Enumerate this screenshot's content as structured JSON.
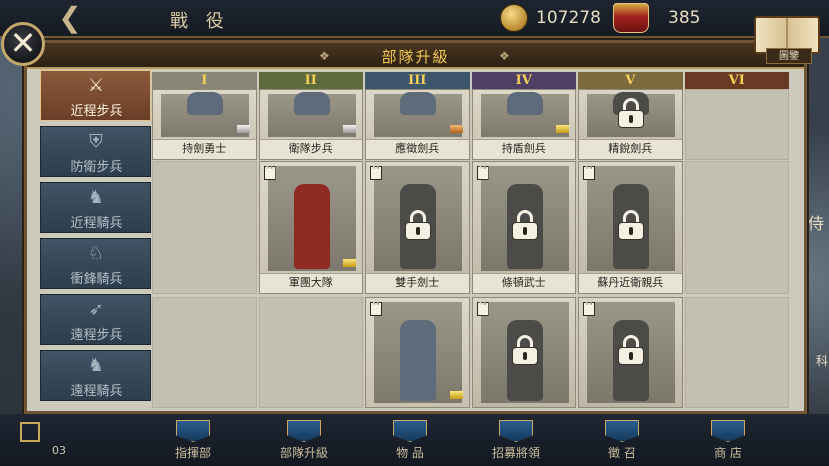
{
  "topbar": {
    "title": "戰 役",
    "coins": "107278",
    "crowns": "385"
  },
  "codex": {
    "label": "圖鑒"
  },
  "panel": {
    "title": "部隊升級"
  },
  "sidebar": {
    "items": [
      {
        "label": "近程步兵",
        "icon": "crossed-swords-icon",
        "active": true
      },
      {
        "label": "防衛步兵",
        "icon": "shield-icon",
        "active": false
      },
      {
        "label": "近程騎兵",
        "icon": "horse-head-icon",
        "active": false
      },
      {
        "label": "衝鋒騎兵",
        "icon": "charging-horse-icon",
        "active": false
      },
      {
        "label": "遠程步兵",
        "icon": "bow-icon",
        "active": false
      },
      {
        "label": "遠程騎兵",
        "icon": "horse-archer-icon",
        "active": false
      }
    ]
  },
  "tiers": [
    "I",
    "II",
    "III",
    "IV",
    "V",
    "VI"
  ],
  "tier_colors": [
    "#8a8676",
    "#5d6a3e",
    "#3d556b",
    "#4e3f66",
    "#7a6a3e",
    "#6a3b24"
  ],
  "units": {
    "row1": [
      {
        "name": "持劍勇士",
        "locked": false,
        "badge": "silver"
      },
      {
        "name": "衛隊步兵",
        "locked": false,
        "badge": "silver"
      },
      {
        "name": "應徵劍兵",
        "locked": false,
        "badge": "bronze"
      },
      {
        "name": "持盾劍兵",
        "locked": false,
        "badge": "gold"
      },
      {
        "name": "精銳劍兵",
        "locked": true,
        "badge": ""
      }
    ],
    "row2": [
      {
        "name": "軍團大隊",
        "locked": false,
        "badge": "gold"
      },
      {
        "name": "雙手劍士",
        "locked": true,
        "badge": ""
      },
      {
        "name": "條頓武士",
        "locked": true,
        "badge": ""
      },
      {
        "name": "蘇丹近衛親兵",
        "locked": true,
        "badge": ""
      }
    ],
    "row3": [
      {
        "name": "",
        "locked": false,
        "badge": "gold"
      },
      {
        "name": "",
        "locked": true,
        "badge": ""
      },
      {
        "name": "",
        "locked": true,
        "badge": ""
      }
    ]
  },
  "bottom_nav": {
    "items": [
      "指揮部",
      "部隊升級",
      "物 品",
      "招募將領",
      "徵 召",
      "商 店"
    ],
    "page_top": "03"
  },
  "edge_labels": {
    "right_top": "侍",
    "right_bottom": "科"
  }
}
